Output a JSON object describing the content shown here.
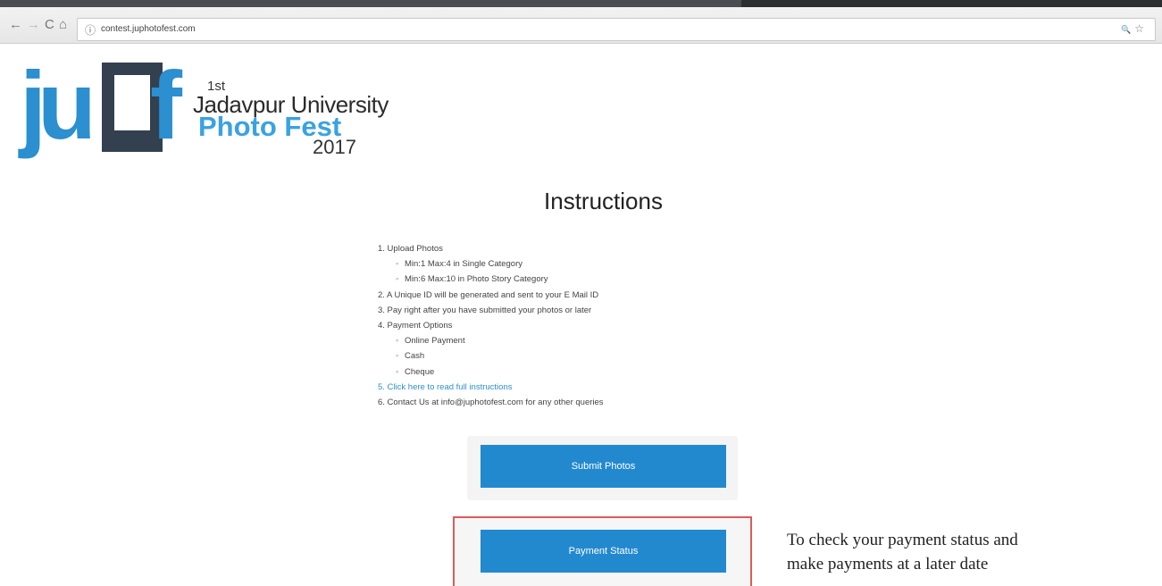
{
  "browser": {
    "back_icon": "←",
    "forward_icon": "→",
    "reload_icon": "C",
    "home_icon": "⌂",
    "info_icon": "ⓘ",
    "url": "contest.juphotofest.com",
    "zoom_icon": "🔍",
    "bookmark_icon": "☆"
  },
  "logo": {
    "ju": "ju",
    "f": "f"
  },
  "brand": {
    "edition": "1st",
    "university": "Jadavpur University",
    "fest": "Photo Fest",
    "year": "2017"
  },
  "main": {
    "title": "Instructions",
    "items": [
      "1. Upload Photos",
      "Min:1 Max:4 in Single Category",
      "Min:6 Max:10 in Photo Story Category",
      "2. A Unique ID will be generated and sent to your E Mail ID",
      "3. Pay right after you have submitted your photos or later",
      "4. Payment Options",
      "Online Payment",
      "Cash",
      "Cheque",
      "5. Click here to read full instructions",
      "6. Contact Us at info@juphotofest.com for any other queries"
    ],
    "submit_label": "Submit Photos",
    "payment_label": "Payment Status"
  },
  "note": {
    "line1": "To check your payment status and",
    "line2": "make payments at a later date"
  },
  "colors": {
    "accent": "#2389cf",
    "highlight_border": "#e05a5a",
    "logo_dark": "#33404f"
  }
}
